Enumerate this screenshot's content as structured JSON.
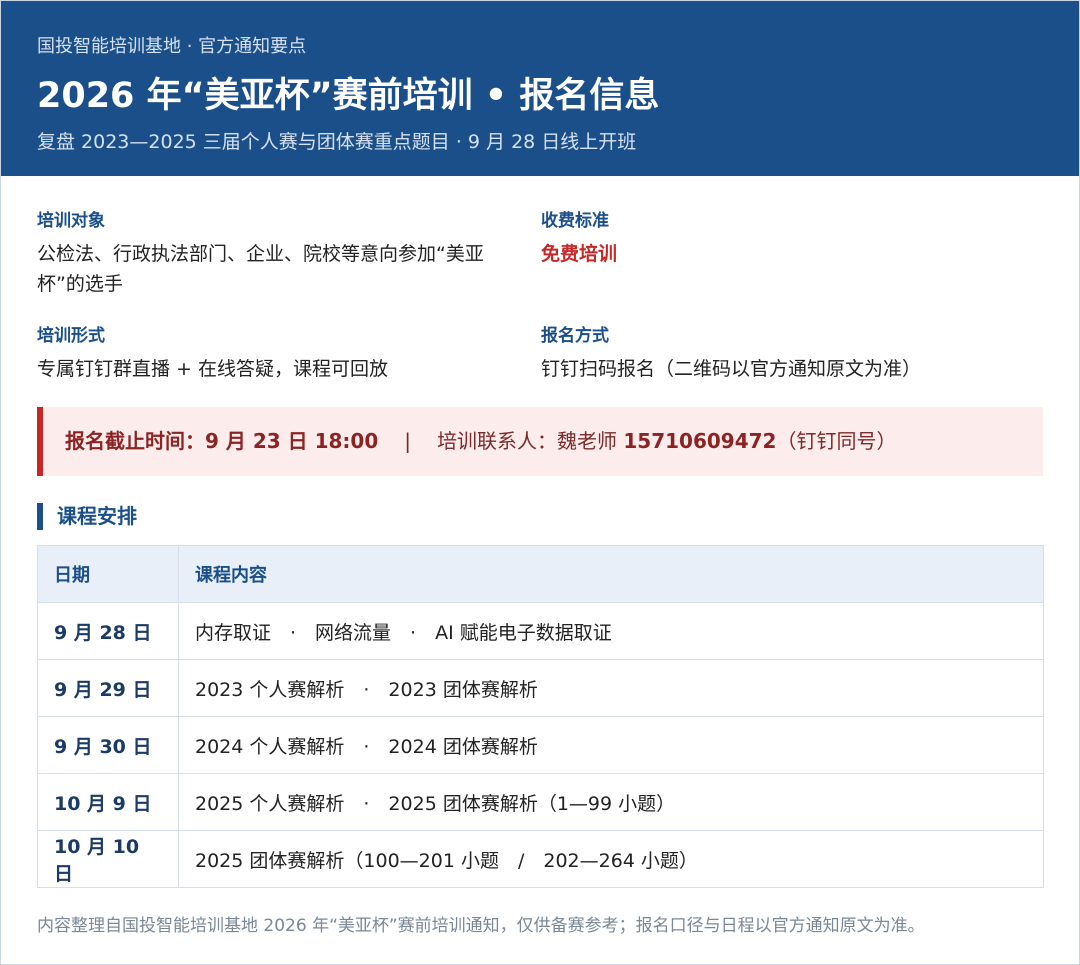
{
  "header": {
    "org": "国投智能培训基地 · 官方通知要点",
    "title": "2026 年“美亚杯”赛前培训 • 报名信息",
    "subtitle": "复盘 2023—2025 三届个人赛与团体赛重点题目 · 9 月 28 日线上开班"
  },
  "info": {
    "target": {
      "label": "培训对象",
      "value": "公检法、行政执法部门、企业、院校等意向参加“美亚杯”的选手"
    },
    "fee": {
      "label": "收费标准",
      "value": "免费培训"
    },
    "format": {
      "label": "培训形式",
      "value": "专属钉钉群直播 + 在线答疑，课程可回放"
    },
    "signup": {
      "label": "报名方式",
      "value": "钉钉扫码报名（二维码以官方通知原文为准）"
    }
  },
  "deadline": {
    "label": "报名截止时间：9 月 23 日 18:00",
    "separator": "|",
    "contact_prefix": "培训联系人：魏老师 ",
    "phone": "15710609472",
    "contact_suffix": "（钉钉同号）"
  },
  "schedule": {
    "title": "课程安排",
    "headers": [
      "日期",
      "课程内容"
    ],
    "rows": [
      {
        "date": "9 月 28 日",
        "content": "内存取证　·　网络流量　·　AI 赋能电子数据取证"
      },
      {
        "date": "9 月 29 日",
        "content": "2023 个人赛解析　·　2023 团体赛解析"
      },
      {
        "date": "9 月 30 日",
        "content": "2024 个人赛解析　·　2024 团体赛解析"
      },
      {
        "date": "10 月 9 日",
        "content": "2025 个人赛解析　·　2025 团体赛解析（1—99 小题）"
      },
      {
        "date": "10 月 10 日",
        "content": "2025 团体赛解析（100—201 小题　/　202—264 小题）"
      }
    ]
  },
  "footer": "内容整理自国投智能培训基地 2026 年“美亚杯”赛前培训通知，仅供备赛参考；报名口径与日程以官方通知原文为准。",
  "colors": {
    "header_bg": "#1b4f8a",
    "accent_red": "#c62828",
    "deadline_bg": "#fcecec",
    "table_head_bg": "#e8eff8"
  }
}
